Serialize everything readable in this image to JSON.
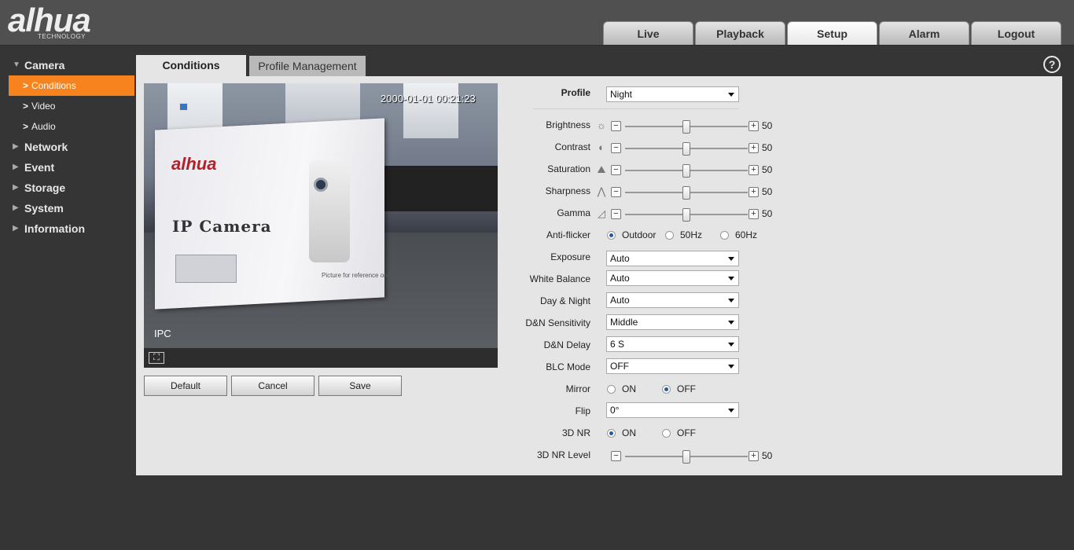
{
  "brand": {
    "logo_text": "alhua",
    "logo_sub": "TECHNOLOGY"
  },
  "topnav": [
    {
      "label": "Live",
      "active": false
    },
    {
      "label": "Playback",
      "active": false
    },
    {
      "label": "Setup",
      "active": true
    },
    {
      "label": "Alarm",
      "active": false
    },
    {
      "label": "Logout",
      "active": false
    }
  ],
  "sidebar": {
    "camera": "Camera",
    "sub_conditions": "Conditions",
    "sub_video": "Video",
    "sub_audio": "Audio",
    "network": "Network",
    "event": "Event",
    "storage": "Storage",
    "system": "System",
    "information": "Information"
  },
  "tabs": {
    "conditions": "Conditions",
    "profile": "Profile Management"
  },
  "help": "?",
  "video": {
    "timestamp": "2000-01-01 00:21:23",
    "channel": "IPC",
    "box_logo": "alhua",
    "box_title": "IP Camera",
    "box_caption": "Picture for reference only."
  },
  "buttons": {
    "default": "Default",
    "cancel": "Cancel",
    "save": "Save"
  },
  "form": {
    "profile": {
      "label": "Profile",
      "value": "Night"
    },
    "brightness": {
      "label": "Brightness",
      "value": 50
    },
    "contrast": {
      "label": "Contrast",
      "value": 50
    },
    "saturation": {
      "label": "Saturation",
      "value": 50
    },
    "sharpness": {
      "label": "Sharpness",
      "value": 50
    },
    "gamma": {
      "label": "Gamma",
      "value": 50
    },
    "antiflicker": {
      "label": "Anti-flicker",
      "opt1": "Outdoor",
      "opt2": "50Hz",
      "opt3": "60Hz",
      "selected": "Outdoor"
    },
    "exposure": {
      "label": "Exposure",
      "value": "Auto"
    },
    "white_balance": {
      "label": "White Balance",
      "value": "Auto"
    },
    "day_night": {
      "label": "Day & Night",
      "value": "Auto"
    },
    "dn_sensitivity": {
      "label": "D&N Sensitivity",
      "value": "Middle"
    },
    "dn_delay": {
      "label": "D&N Delay",
      "value": "6 S"
    },
    "blc_mode": {
      "label": "BLC Mode",
      "value": "OFF"
    },
    "mirror": {
      "label": "Mirror",
      "on": "ON",
      "off": "OFF",
      "selected": "OFF"
    },
    "flip": {
      "label": "Flip",
      "value": "0°"
    },
    "nr3d": {
      "label": "3D NR",
      "on": "ON",
      "off": "OFF",
      "selected": "ON"
    },
    "nr3d_level": {
      "label": "3D NR Level",
      "value": 50
    }
  },
  "icons": {
    "brightness": "sun-icon",
    "contrast": "contrast-icon",
    "saturation": "saturation-icon",
    "sharpness": "sharpness-icon",
    "gamma": "gamma-icon",
    "fullscreen": "fullscreen-icon",
    "help": "help-icon"
  },
  "colors": {
    "accent": "#f7831e",
    "panel": "#e5e5e5",
    "background": "#353535",
    "radio": "#1e5aa8"
  }
}
